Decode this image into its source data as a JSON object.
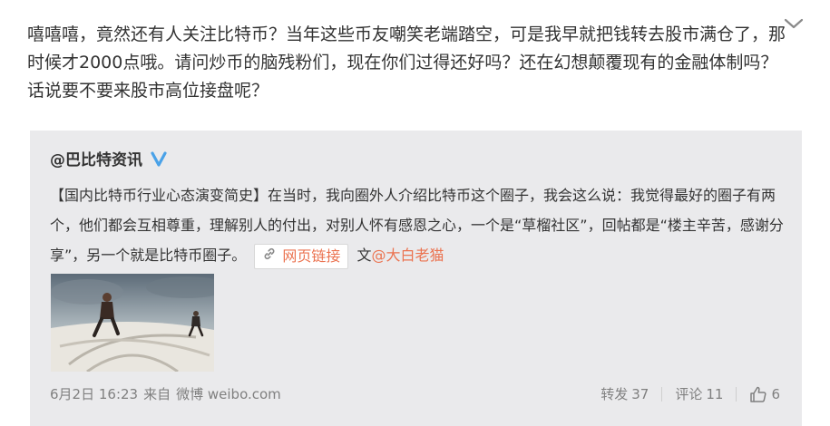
{
  "post": {
    "text": "嘻嘻嘻，竟然还有人关注比特币？当年这些币友嘲笑老端踏空，可是我早就把钱转去股市满仓了，那时候才2000点哦。请问炒币的脑残粉们，现在你们过得还好吗？还在幻想颠覆现有的金融体制吗？话说要不要来股市高位接盘呢？"
  },
  "repost": {
    "author": "@巴比特资讯",
    "text_before_link": "【国内比特币行业心态演变简史】在当时，我向圈外人介绍比特币这个圈子，我会这么说：我觉得最好的圈子有两个，他们都会互相尊重，理解别人的付出，对别人怀有感恩之心，一个是“草榴社区”，回帖都是“楼主辛苦，感谢分享”，另一个就是比特币圈子。",
    "link_label": "网页链接",
    "credit_prefix": "文",
    "credit_mention": "@大白老猫",
    "date": "6月2日 16:23",
    "source_prefix": "来自",
    "source": "微博 weibo.com",
    "repost_label": "转发",
    "repost_count": "37",
    "comment_label": "评论",
    "comment_count": "11",
    "like_count": "6"
  },
  "icons": {
    "menu": "chevron-down-icon",
    "verified": "verified-icon",
    "link": "link-icon",
    "like": "thumbs-up-icon"
  },
  "colors": {
    "accent": "#eb7350",
    "verified": "#4aa2e8",
    "repost_bg": "#eaeaec",
    "meta_text": "#808080"
  }
}
